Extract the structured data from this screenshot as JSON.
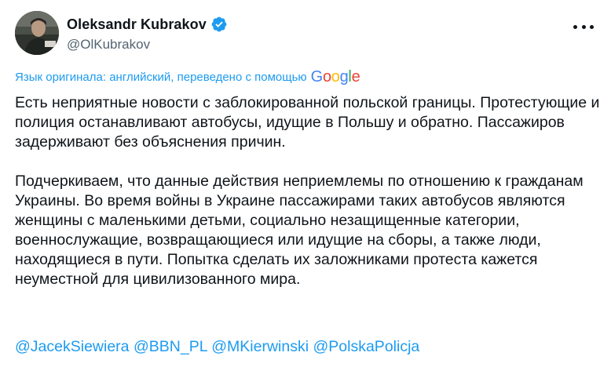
{
  "author": {
    "display_name": "Oleksandr Kubrakov",
    "handle": "@OlKubrakov",
    "verified": true
  },
  "translation": {
    "notice": "Язык оригинала: английский, переведено с помощью",
    "provider_letters": [
      "G",
      "o",
      "o",
      "g",
      "l",
      "e"
    ]
  },
  "tweet": {
    "paragraphs": [
      "Есть неприятные новости с заблокированной польской границы. Протестующие и полиция останавливают автобусы, идущие в Польшу и обратно. Пассажиров задерживают без объяснения причин.",
      "Подчеркиваем, что данные действия неприемлемы по отношению к гражданам Украины. Во время войны в Украине пассажирами таких автобусов являются женщины с маленькими детьми, социально незащищенные категории, военнослужащие, возвращающиеся или идущие на сборы, а также люди, находящиеся в пути. Попытка сделать их заложниками протеста кажется неуместной для цивилизованного мира."
    ],
    "mentions": [
      "@JacekSiewiera",
      "@BBN_PL",
      "@MKierwinski",
      "@PolskaPolicja"
    ]
  },
  "icons": {
    "verified": "verified-badge-icon",
    "more": "more-options-icon",
    "avatar": "profile-photo"
  },
  "colors": {
    "link": "#1d9bf0",
    "text": "#0f1419",
    "secondary": "#536471",
    "verified": "#1d9bf0"
  }
}
